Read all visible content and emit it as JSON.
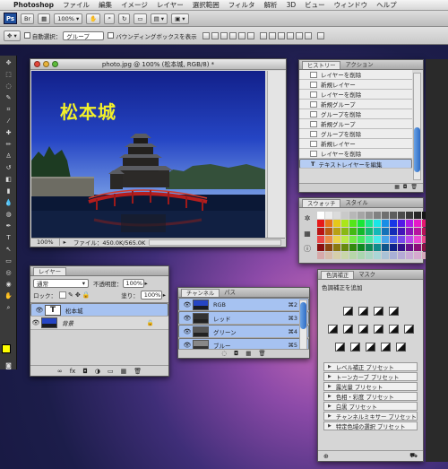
{
  "menubar": {
    "apple": "",
    "items": [
      "Photoshop",
      "ファイル",
      "編集",
      "イメージ",
      "レイヤー",
      "選択範囲",
      "フィルタ",
      "解析",
      "3D",
      "ビュー",
      "ウィンドウ",
      "ヘルプ"
    ]
  },
  "appbar": {
    "ps_badge": "Ps",
    "zoom": "100%"
  },
  "options": {
    "auto_select_label": "自動選択：",
    "auto_select_value": "グループ",
    "bounding_label": "バウンディングボックスを表示"
  },
  "document": {
    "title": "photo.jpg @ 100% (松本城, RGB/8) *",
    "overlay_text": "松本城",
    "zoom": "100%",
    "file_info": "ファイル：450.0K/565.0K"
  },
  "history": {
    "tabs": [
      "ヒストリー",
      "アクション"
    ],
    "items": [
      "レイヤーを削除",
      "新規レイヤー",
      "レイヤーを削除",
      "新規グループ",
      "グループを削除",
      "新規グループ",
      "グループを削除",
      "新規レイヤー",
      "レイヤーを削除",
      "テキストレイヤーを編集"
    ]
  },
  "swatches": {
    "tabs": [
      "スウォッチ",
      "スタイル"
    ]
  },
  "adjust": {
    "tabs": [
      "色調補正",
      "マスク"
    ],
    "heading": "色調補正を追加",
    "presets": [
      "レベル補正 プリセット",
      "トーンカーブ プリセット",
      "露光量 プリセット",
      "色相・彩度 プリセット",
      "白黒 プリセット",
      "チャンネルミキサー プリセット",
      "特定色域の選択 プリセット"
    ]
  },
  "layers": {
    "tab": "レイヤー",
    "blend_mode": "通常",
    "opacity_label": "不透明度：",
    "opacity_value": "100%",
    "lock_label": "ロック：",
    "fill_label": "塗り：",
    "fill_value": "100%",
    "items": [
      {
        "type": "T",
        "name": "松本城"
      },
      {
        "type": "img",
        "name": "背景"
      }
    ]
  },
  "channels": {
    "tabs": [
      "チャンネル",
      "パス"
    ],
    "items": [
      {
        "name": "RGB",
        "shortcut": "⌘2"
      },
      {
        "name": "レッド",
        "shortcut": "⌘3"
      },
      {
        "name": "グリーン",
        "shortcut": "⌘4"
      },
      {
        "name": "ブルー",
        "shortcut": "⌘5"
      }
    ]
  },
  "colors": {
    "accent_blue": "#b6cdf3",
    "fg_swatch": "#ffff00"
  }
}
